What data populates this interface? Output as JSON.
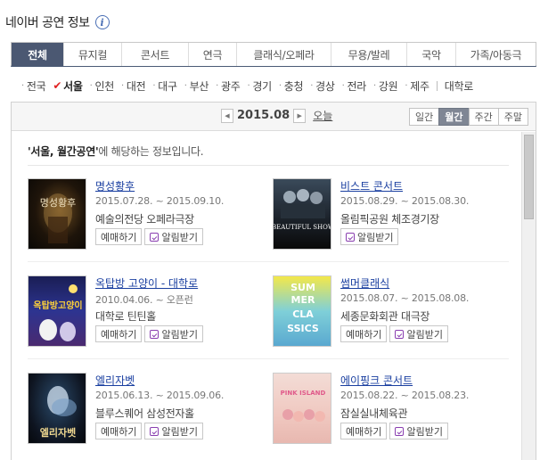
{
  "header": {
    "title": "네이버 공연 정보",
    "info_icon": "i"
  },
  "genre_tabs": [
    {
      "label": "전체",
      "active": true
    },
    {
      "label": "뮤지컬"
    },
    {
      "label": "콘서트"
    },
    {
      "label": "연극"
    },
    {
      "label": "클래식/오페라"
    },
    {
      "label": "무용/발레"
    },
    {
      "label": "국악"
    },
    {
      "label": "가족/아동극"
    }
  ],
  "regions": [
    "전국",
    "서울",
    "인천",
    "대전",
    "대구",
    "부산",
    "광주",
    "경기",
    "충청",
    "경상",
    "전라",
    "강원",
    "제주",
    "대학로"
  ],
  "selected_region": "서울",
  "toolbar": {
    "month": "2015.08",
    "prev_icon": "◀",
    "next_icon": "▶",
    "today": "오늘",
    "views": [
      "일간",
      "월간",
      "주간",
      "주말"
    ],
    "active_view": "월간"
  },
  "context": {
    "highlight": "'서울, 월간공연'",
    "suffix": "에 해당하는 정보입니다."
  },
  "events": [
    {
      "title": "명성황후",
      "date": "2015.07.28. ~ 2015.09.10.",
      "venue": "예술의전당 오페라극장",
      "book": "예매하기",
      "notify": "알림받기"
    },
    {
      "title": "비스트 콘서트",
      "date": "2015.08.29. ~ 2015.08.30.",
      "venue": "올림픽공원 체조경기장",
      "book": "",
      "notify": "알림받기"
    },
    {
      "title": "옥탑방 고양이 - 대학로",
      "date": "2010.04.06. ~ 오픈런",
      "venue": "대학로 틴틴홀",
      "book": "예매하기",
      "notify": "알림받기"
    },
    {
      "title": "썸머클래식",
      "date": "2015.08.07. ~ 2015.08.08.",
      "venue": "세종문화회관 대극장",
      "book": "예매하기",
      "notify": "알림받기"
    },
    {
      "title": "엘리자벳",
      "date": "2015.06.13. ~ 2015.09.06.",
      "venue": "블루스퀘어 삼성전자홀",
      "book": "예매하기",
      "notify": "알림받기"
    },
    {
      "title": "에이핑크 콘서트",
      "date": "2015.08.22. ~ 2015.08.23.",
      "venue": "잠실실내체육관",
      "book": "예매하기",
      "notify": "알림받기"
    }
  ],
  "poster_text": {
    "p1": "명성황후",
    "p2": "BEAUTIFUL SHOW",
    "p3": "옥탑방고양이",
    "p4": [
      "SUM",
      "MER",
      "CLA",
      "SSICS"
    ],
    "p5": "엘리자벳",
    "p6": "PINK ISLAND"
  },
  "colors": {
    "tab_active": "#4b5872",
    "link": "#1a3fa0",
    "check": "#e02020"
  }
}
